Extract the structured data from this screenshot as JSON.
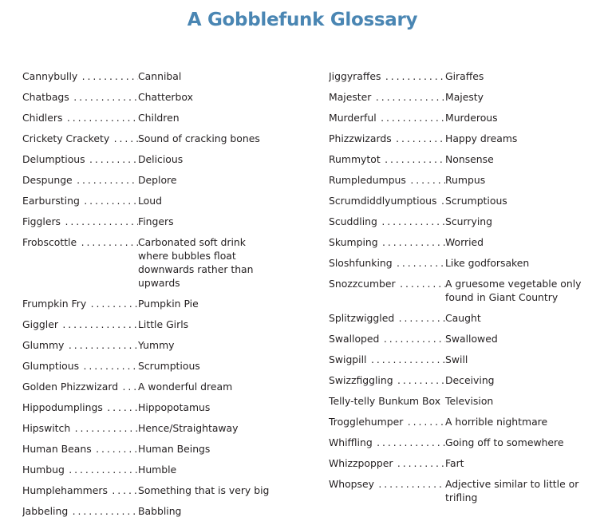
{
  "title": "A Gobblefunk Glossary",
  "columns": [
    {
      "entries": [
        {
          "term": "Cannybully",
          "definition": "Cannibal"
        },
        {
          "term": "Chatbags",
          "definition": "Chatterbox"
        },
        {
          "term": "Chidlers",
          "definition": "Children"
        },
        {
          "term": "Crickety Crackety",
          "definition": "Sound of cracking bones"
        },
        {
          "term": "Delumptious",
          "definition": "Delicious"
        },
        {
          "term": "Despunge",
          "definition": "Deplore"
        },
        {
          "term": "Earbursting",
          "definition": "Loud"
        },
        {
          "term": "Figglers",
          "definition": "Fingers"
        },
        {
          "term": "Frobscottle",
          "definition": "Carbonated soft drink where bubbles float downwards rather than upwards"
        },
        {
          "term": "Frumpkin Fry",
          "definition": "Pumpkin Pie"
        },
        {
          "term": "Giggler",
          "definition": "Little Girls"
        },
        {
          "term": "Glummy",
          "definition": "Yummy"
        },
        {
          "term": "Glumptious",
          "definition": "Scrumptious"
        },
        {
          "term": "Golden Phizzwizard",
          "definition": "A wonderful dream"
        },
        {
          "term": "Hippodumplings",
          "definition": "Hippopotamus"
        },
        {
          "term": "Hipswitch",
          "definition": "Hence/Straightaway"
        },
        {
          "term": "Human Beans",
          "definition": "Human Beings"
        },
        {
          "term": "Humbug",
          "definition": "Humble"
        },
        {
          "term": "Humplehammers",
          "definition": "Something that is very big"
        },
        {
          "term": "Jabbeling",
          "definition": "Babbling"
        }
      ]
    },
    {
      "entries": [
        {
          "term": "Jiggyraffes",
          "definition": "Giraffes"
        },
        {
          "term": "Majester",
          "definition": "Majesty"
        },
        {
          "term": "Murderful",
          "definition": "Murderous"
        },
        {
          "term": "Phizzwizards",
          "definition": "Happy dreams"
        },
        {
          "term": "Rummytot",
          "definition": "Nonsense"
        },
        {
          "term": "Rumpledumpus",
          "definition": "Rumpus"
        },
        {
          "term": "Scrumdiddlyumptious",
          "definition": "Scrumptious"
        },
        {
          "term": "Scuddling",
          "definition": "Scurrying"
        },
        {
          "term": "Skumping",
          "definition": "Worried"
        },
        {
          "term": "Sloshfunking",
          "definition": "Like godforsaken"
        },
        {
          "term": "Snozzcumber",
          "definition": "A gruesome vegetable only found in Giant Country"
        },
        {
          "term": "Splitzwiggled",
          "definition": "Caught"
        },
        {
          "term": "Swalloped",
          "definition": "Swallowed"
        },
        {
          "term": "Swigpill",
          "definition": "Swill"
        },
        {
          "term": "Swizzfiggling",
          "definition": "Deceiving"
        },
        {
          "term": "Telly-telly Bunkum Box",
          "definition": "Television"
        },
        {
          "term": "Trogglehumper",
          "definition": "A horrible nightmare"
        },
        {
          "term": "Whiffling",
          "definition": "Going off to somewhere"
        },
        {
          "term": "Whizzpopper",
          "definition": "Fart"
        },
        {
          "term": "Whopsey",
          "definition": "Adjective similar to little or trifling"
        }
      ]
    }
  ]
}
